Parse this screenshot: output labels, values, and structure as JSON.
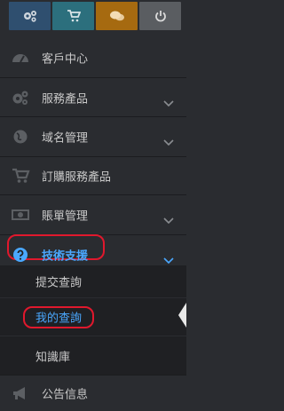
{
  "topbar": {
    "buttons": [
      {
        "icon": "gears-icon",
        "color": "#2f4f6f"
      },
      {
        "icon": "cart-icon",
        "color": "#2c6f7d"
      },
      {
        "icon": "comments-icon",
        "color": "#a66a10"
      },
      {
        "icon": "power-icon",
        "color": "#5a5d61"
      }
    ]
  },
  "menu": {
    "items": [
      {
        "label": "客戶中心",
        "icon": "dashboard-icon"
      },
      {
        "label": "服務產品",
        "icon": "gears-icon"
      },
      {
        "label": "域名管理",
        "icon": "globe-icon"
      },
      {
        "label": "訂購服務產品",
        "icon": "cart-icon"
      },
      {
        "label": "賬單管理",
        "icon": "money-icon"
      },
      {
        "label": "技術支援",
        "icon": "question-circle-icon"
      },
      {
        "label": "公告信息",
        "icon": "bullhorn-icon"
      }
    ],
    "support_subitems": [
      {
        "label": "提交查詢"
      },
      {
        "label": "我的查詢"
      },
      {
        "label": "知識庫"
      }
    ]
  },
  "colors": {
    "background": "#2a2c30",
    "submenu_background": "#1f2023",
    "highlight_border": "#e0182d",
    "active_text": "#4aa8ff",
    "text": "#c9c9c9"
  }
}
